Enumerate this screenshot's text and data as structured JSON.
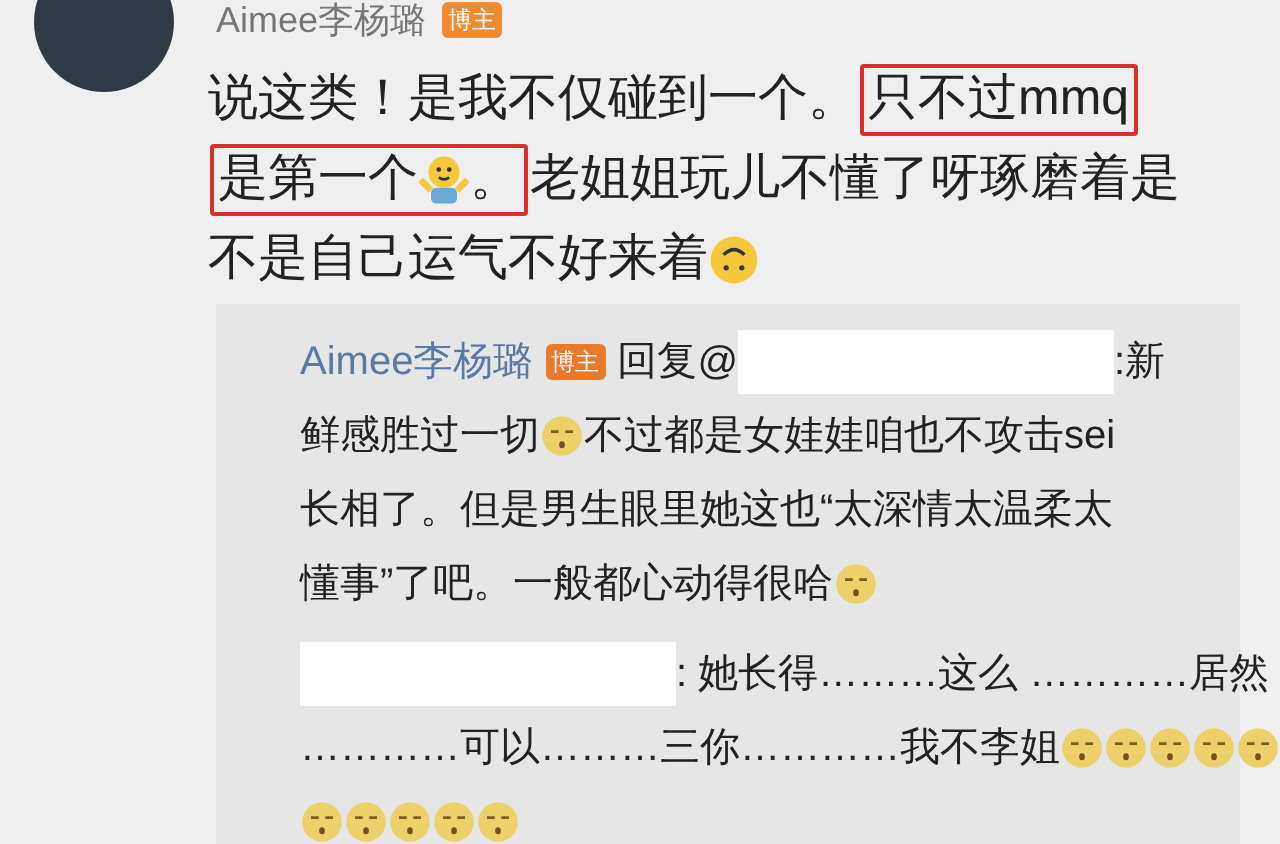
{
  "post": {
    "author": "Aimee李杨璐",
    "badge": "博主",
    "lines": [
      [
        {
          "kind": "text",
          "text": "说这类！是我不仅碰到一个。"
        },
        {
          "kind": "box",
          "children": [
            {
              "kind": "text",
              "text": "只不过mmq"
            }
          ]
        }
      ],
      [
        {
          "kind": "box",
          "children": [
            {
              "kind": "text",
              "text": "是第一个"
            },
            {
              "kind": "emoji-shrug"
            },
            {
              "kind": "text",
              "text": "。"
            }
          ]
        },
        {
          "kind": "text",
          "text": "老姐姐玩儿不懂了呀琢磨着是"
        }
      ],
      [
        {
          "kind": "text",
          "text": "不是自己运气不好来着"
        },
        {
          "kind": "emoji-upside"
        }
      ]
    ]
  },
  "reply": {
    "lines": [
      [
        {
          "kind": "author",
          "text": "Aimee李杨璐"
        },
        {
          "kind": "badge",
          "text": "博主"
        },
        {
          "kind": "text",
          "text": "回复@"
        },
        {
          "kind": "redacted"
        },
        {
          "kind": "text",
          "text": ":新"
        }
      ],
      [
        {
          "kind": "text",
          "text": "鲜感胜过一切"
        },
        {
          "kind": "emoji-sleepy"
        },
        {
          "kind": "text",
          "text": "不过都是女娃娃咱也不攻击sei"
        }
      ],
      [
        {
          "kind": "text",
          "text": "长相了。但是男生眼里她这也“太深情太温柔太"
        }
      ],
      [
        {
          "kind": "text",
          "text": "懂事”了吧。一般都心动得很哈"
        },
        {
          "kind": "emoji-sleepy"
        }
      ],
      [
        {
          "kind": "redacted"
        },
        {
          "kind": "text",
          "text": ": 她长得………这么 …………居然"
        }
      ],
      [
        {
          "kind": "text",
          "text": "…………可以………三你…………我不李姐"
        },
        {
          "kind": "emoji-sleepy"
        },
        {
          "kind": "emoji-sleepy"
        },
        {
          "kind": "emoji-sleepy"
        },
        {
          "kind": "emoji-sleepy"
        },
        {
          "kind": "emoji-sleepy"
        }
      ],
      [
        {
          "kind": "emoji-sleepy"
        },
        {
          "kind": "emoji-sleepy"
        },
        {
          "kind": "emoji-sleepy"
        },
        {
          "kind": "emoji-sleepy"
        },
        {
          "kind": "emoji-sleepy"
        }
      ]
    ]
  }
}
